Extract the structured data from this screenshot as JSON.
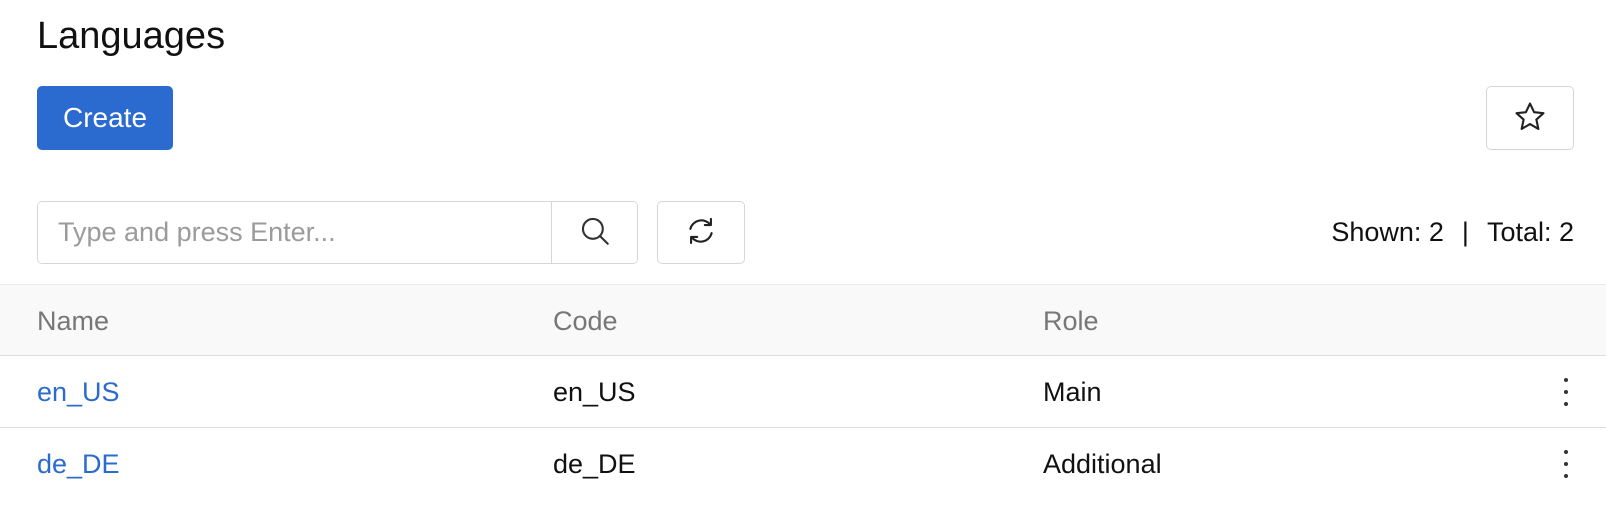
{
  "header": {
    "title": "Languages"
  },
  "toolbar": {
    "create_label": "Create",
    "favorite_icon": "star-icon"
  },
  "search": {
    "placeholder": "Type and press Enter...",
    "value": "",
    "search_icon": "search-icon",
    "refresh_icon": "refresh-icon"
  },
  "counts": {
    "shown": "Shown: 2",
    "separator": "|",
    "total": "Total: 2"
  },
  "table": {
    "columns": [
      "Name",
      "Code",
      "Role"
    ],
    "rows": [
      {
        "name": "en_US",
        "code": "en_US",
        "role": "Main"
      },
      {
        "name": "de_DE",
        "code": "de_DE",
        "role": "Additional"
      }
    ],
    "row_menu_icon": "kebab-menu-icon"
  },
  "colors": {
    "accent": "#2b6acf",
    "header_bg": "#f9f9f9",
    "border": "#d6d6d6",
    "muted_text": "#777777"
  }
}
